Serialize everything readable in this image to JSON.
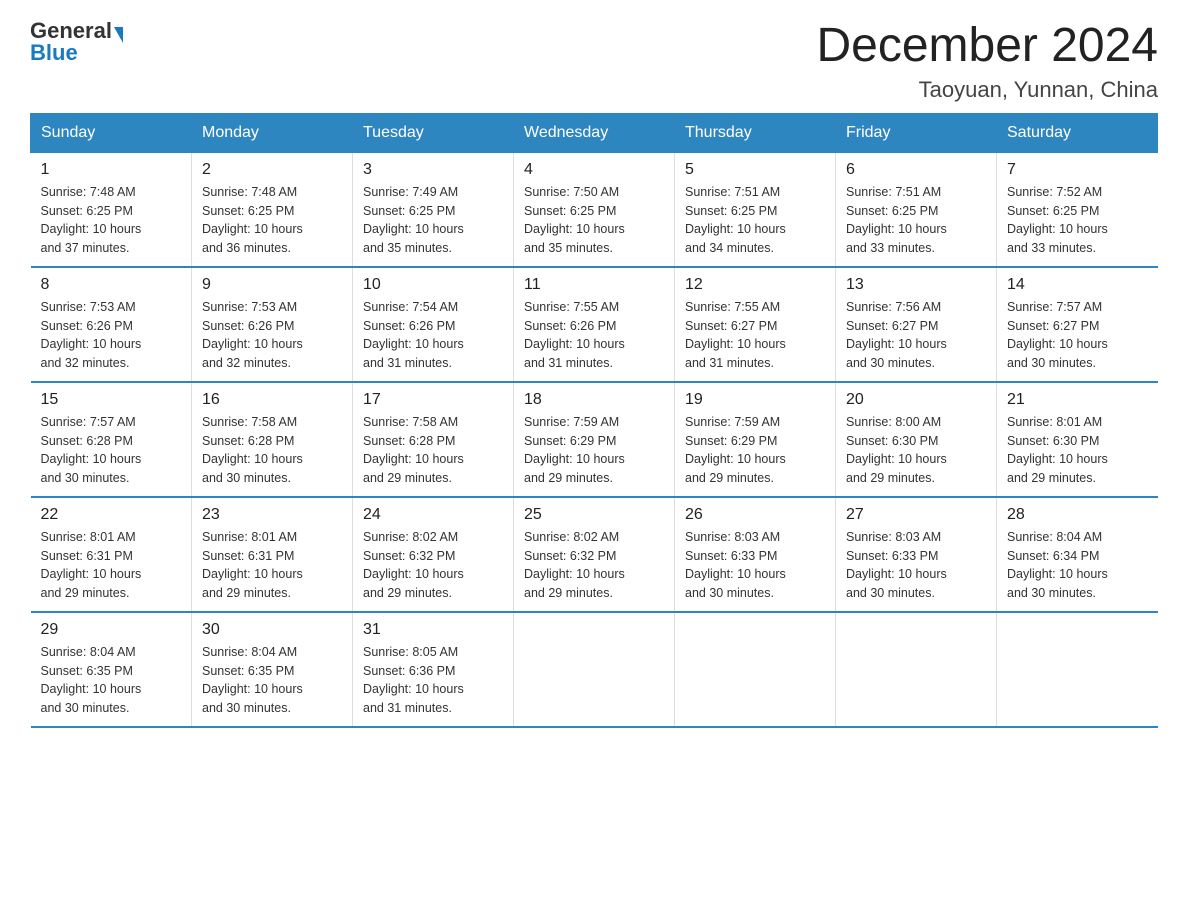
{
  "logo": {
    "text_general": "General",
    "text_blue": "Blue"
  },
  "header": {
    "month": "December 2024",
    "location": "Taoyuan, Yunnan, China"
  },
  "weekdays": [
    "Sunday",
    "Monday",
    "Tuesday",
    "Wednesday",
    "Thursday",
    "Friday",
    "Saturday"
  ],
  "weeks": [
    [
      {
        "day": "1",
        "sunrise": "7:48 AM",
        "sunset": "6:25 PM",
        "daylight": "10 hours and 37 minutes."
      },
      {
        "day": "2",
        "sunrise": "7:48 AM",
        "sunset": "6:25 PM",
        "daylight": "10 hours and 36 minutes."
      },
      {
        "day": "3",
        "sunrise": "7:49 AM",
        "sunset": "6:25 PM",
        "daylight": "10 hours and 35 minutes."
      },
      {
        "day": "4",
        "sunrise": "7:50 AM",
        "sunset": "6:25 PM",
        "daylight": "10 hours and 35 minutes."
      },
      {
        "day": "5",
        "sunrise": "7:51 AM",
        "sunset": "6:25 PM",
        "daylight": "10 hours and 34 minutes."
      },
      {
        "day": "6",
        "sunrise": "7:51 AM",
        "sunset": "6:25 PM",
        "daylight": "10 hours and 33 minutes."
      },
      {
        "day": "7",
        "sunrise": "7:52 AM",
        "sunset": "6:25 PM",
        "daylight": "10 hours and 33 minutes."
      }
    ],
    [
      {
        "day": "8",
        "sunrise": "7:53 AM",
        "sunset": "6:26 PM",
        "daylight": "10 hours and 32 minutes."
      },
      {
        "day": "9",
        "sunrise": "7:53 AM",
        "sunset": "6:26 PM",
        "daylight": "10 hours and 32 minutes."
      },
      {
        "day": "10",
        "sunrise": "7:54 AM",
        "sunset": "6:26 PM",
        "daylight": "10 hours and 31 minutes."
      },
      {
        "day": "11",
        "sunrise": "7:55 AM",
        "sunset": "6:26 PM",
        "daylight": "10 hours and 31 minutes."
      },
      {
        "day": "12",
        "sunrise": "7:55 AM",
        "sunset": "6:27 PM",
        "daylight": "10 hours and 31 minutes."
      },
      {
        "day": "13",
        "sunrise": "7:56 AM",
        "sunset": "6:27 PM",
        "daylight": "10 hours and 30 minutes."
      },
      {
        "day": "14",
        "sunrise": "7:57 AM",
        "sunset": "6:27 PM",
        "daylight": "10 hours and 30 minutes."
      }
    ],
    [
      {
        "day": "15",
        "sunrise": "7:57 AM",
        "sunset": "6:28 PM",
        "daylight": "10 hours and 30 minutes."
      },
      {
        "day": "16",
        "sunrise": "7:58 AM",
        "sunset": "6:28 PM",
        "daylight": "10 hours and 30 minutes."
      },
      {
        "day": "17",
        "sunrise": "7:58 AM",
        "sunset": "6:28 PM",
        "daylight": "10 hours and 29 minutes."
      },
      {
        "day": "18",
        "sunrise": "7:59 AM",
        "sunset": "6:29 PM",
        "daylight": "10 hours and 29 minutes."
      },
      {
        "day": "19",
        "sunrise": "7:59 AM",
        "sunset": "6:29 PM",
        "daylight": "10 hours and 29 minutes."
      },
      {
        "day": "20",
        "sunrise": "8:00 AM",
        "sunset": "6:30 PM",
        "daylight": "10 hours and 29 minutes."
      },
      {
        "day": "21",
        "sunrise": "8:01 AM",
        "sunset": "6:30 PM",
        "daylight": "10 hours and 29 minutes."
      }
    ],
    [
      {
        "day": "22",
        "sunrise": "8:01 AM",
        "sunset": "6:31 PM",
        "daylight": "10 hours and 29 minutes."
      },
      {
        "day": "23",
        "sunrise": "8:01 AM",
        "sunset": "6:31 PM",
        "daylight": "10 hours and 29 minutes."
      },
      {
        "day": "24",
        "sunrise": "8:02 AM",
        "sunset": "6:32 PM",
        "daylight": "10 hours and 29 minutes."
      },
      {
        "day": "25",
        "sunrise": "8:02 AM",
        "sunset": "6:32 PM",
        "daylight": "10 hours and 29 minutes."
      },
      {
        "day": "26",
        "sunrise": "8:03 AM",
        "sunset": "6:33 PM",
        "daylight": "10 hours and 30 minutes."
      },
      {
        "day": "27",
        "sunrise": "8:03 AM",
        "sunset": "6:33 PM",
        "daylight": "10 hours and 30 minutes."
      },
      {
        "day": "28",
        "sunrise": "8:04 AM",
        "sunset": "6:34 PM",
        "daylight": "10 hours and 30 minutes."
      }
    ],
    [
      {
        "day": "29",
        "sunrise": "8:04 AM",
        "sunset": "6:35 PM",
        "daylight": "10 hours and 30 minutes."
      },
      {
        "day": "30",
        "sunrise": "8:04 AM",
        "sunset": "6:35 PM",
        "daylight": "10 hours and 30 minutes."
      },
      {
        "day": "31",
        "sunrise": "8:05 AM",
        "sunset": "6:36 PM",
        "daylight": "10 hours and 31 minutes."
      },
      null,
      null,
      null,
      null
    ]
  ],
  "labels": {
    "sunrise": "Sunrise:",
    "sunset": "Sunset:",
    "daylight": "Daylight:"
  }
}
